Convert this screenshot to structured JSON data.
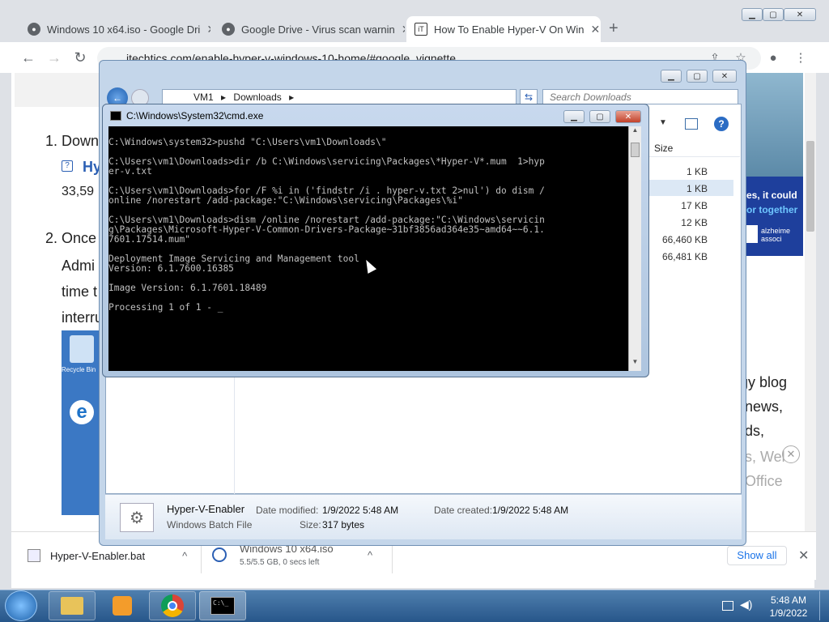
{
  "browser": {
    "tabs": [
      {
        "label": "Windows 10 x64.iso - Google Dri",
        "icon": "google-drive-icon"
      },
      {
        "label": "Google Drive - Virus scan warnin",
        "icon": "google-drive-icon"
      },
      {
        "label": "How To Enable Hyper-V On Win",
        "icon": "itechtics-icon"
      }
    ],
    "new_tab": "+",
    "url": "itechtics.com/enable-hyper-v-windows-10-home/#google_vignette"
  },
  "article": {
    "step1": "1. Down",
    "link_text": "Hy",
    "size_text": "33,59",
    "step2": "2. Once",
    "line2": "Admi",
    "line3": "time t",
    "line4": "interru",
    "right1": "gy blog",
    "right2": "news,",
    "right3": "ds,",
    "right4": "s, Wel",
    "right5": "Office",
    "ad_line1": "es, it could",
    "ad_line2": "or together",
    "ad_logo": "alzheime associ",
    "desktop_recycle": "Recycle Bin",
    "desktop_edge": "Microsoft Edge"
  },
  "explorer": {
    "breadcrumb": [
      "VM1",
      "Downloads"
    ],
    "search_placeholder": "Search Downloads",
    "col_size": "Size",
    "sizes": [
      "1 KB",
      "1 KB",
      "17 KB",
      "12 KB",
      "66,460 KB",
      "66,481 KB"
    ],
    "details": {
      "filename": "Hyper-V-Enabler",
      "filetype": "Windows Batch File",
      "modified_label": "Date modified:",
      "modified_value": "1/9/2022 5:48 AM",
      "created_label": "Date created:",
      "created_value": "1/9/2022 5:48 AM",
      "size_label": "Size:",
      "size_value": "317 bytes"
    }
  },
  "cmd": {
    "title": "C:\\Windows\\System32\\cmd.exe",
    "lines": [
      "C:\\Windows\\system32>pushd \"C:\\Users\\vm1\\Downloads\\\"",
      "",
      "C:\\Users\\vm1\\Downloads>dir /b C:\\Windows\\servicing\\Packages\\*Hyper-V*.mum  1>hyp",
      "er-v.txt",
      "",
      "C:\\Users\\vm1\\Downloads>for /F %i in ('findstr /i . hyper-v.txt 2>nul') do dism /",
      "online /norestart /add-package:\"C:\\Windows\\servicing\\Packages\\%i\"",
      "",
      "C:\\Users\\vm1\\Downloads>dism /online /norestart /add-package:\"C:\\Windows\\servicin",
      "g\\Packages\\Microsoft-Hyper-V-Common-Drivers-Package~31bf3856ad364e35~amd64~~6.1.",
      "7601.17514.mum\"",
      "",
      "Deployment Image Servicing and Management tool",
      "Version: 6.1.7600.16385",
      "",
      "Image Version: 6.1.7601.18489",
      "",
      "Processing 1 of 1 - _"
    ]
  },
  "downloads": {
    "item1": "Hyper-V-Enabler.bat",
    "item2_name": "Windows 10 x64.iso",
    "item2_status": "5.5/5.5 GB, 0 secs left",
    "show_all": "Show all"
  },
  "taskbar": {
    "time": "5:48 AM",
    "date": "1/9/2022"
  }
}
